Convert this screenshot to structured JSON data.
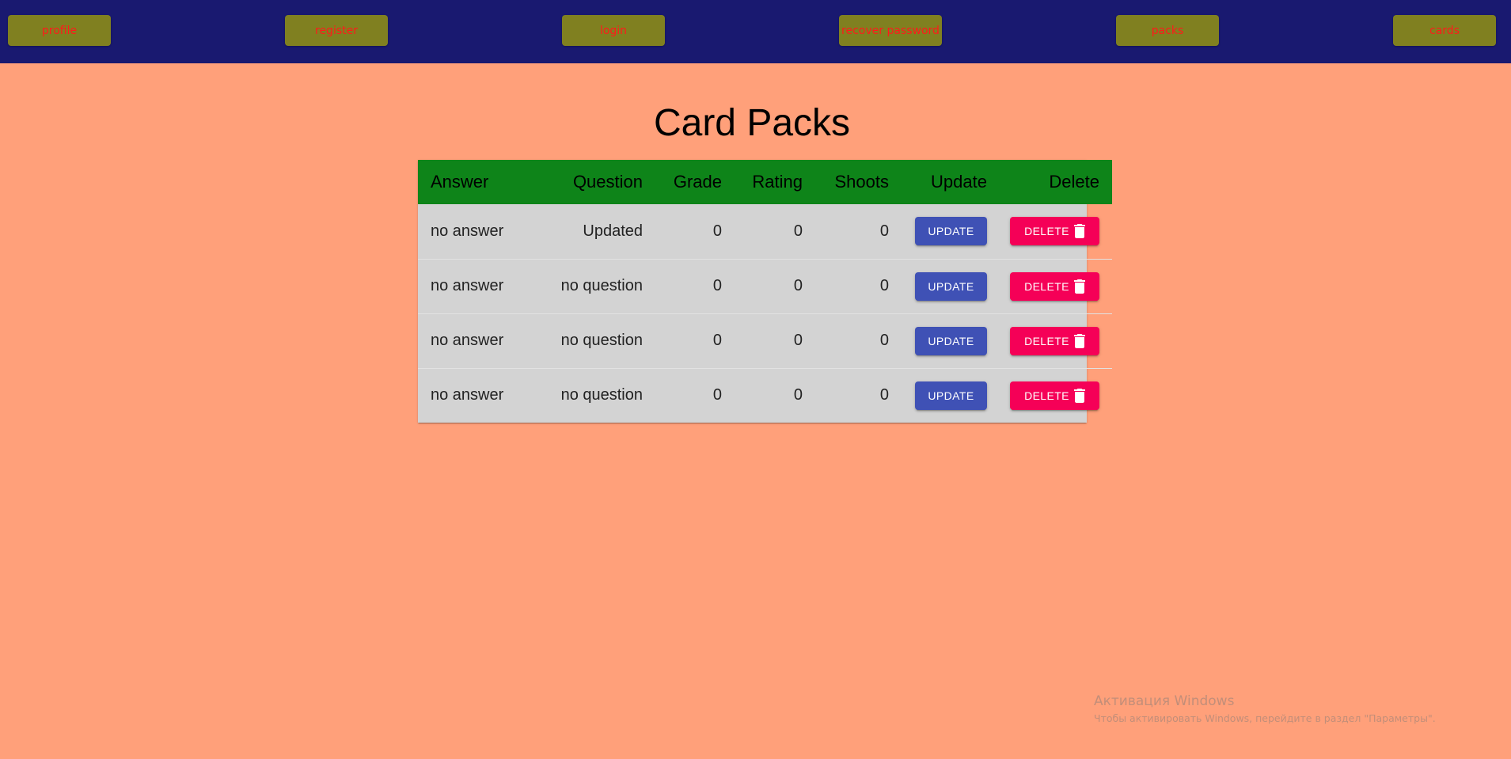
{
  "nav": {
    "items": [
      {
        "label": "profile"
      },
      {
        "label": "register"
      },
      {
        "label": "login"
      },
      {
        "label": "recover password"
      },
      {
        "label": "packs"
      },
      {
        "label": "cards"
      }
    ]
  },
  "page": {
    "title": "Card Packs"
  },
  "table": {
    "headers": {
      "answer": "Answer",
      "question": "Question",
      "grade": "Grade",
      "rating": "Rating",
      "shoots": "Shoots",
      "update": "Update",
      "delete": "Delete"
    },
    "rows": [
      {
        "answer": "no answer",
        "question": "Updated",
        "grade": "0",
        "rating": "0",
        "shoots": "0",
        "update_label": "UPDATE",
        "delete_label": "DELETE"
      },
      {
        "answer": "no answer",
        "question": "no question",
        "grade": "0",
        "rating": "0",
        "shoots": "0",
        "update_label": "UPDATE",
        "delete_label": "DELETE"
      },
      {
        "answer": "no answer",
        "question": "no question",
        "grade": "0",
        "rating": "0",
        "shoots": "0",
        "update_label": "UPDATE",
        "delete_label": "DELETE"
      },
      {
        "answer": "no answer",
        "question": "no question",
        "grade": "0",
        "rating": "0",
        "shoots": "0",
        "update_label": "UPDATE",
        "delete_label": "DELETE"
      }
    ]
  },
  "watermark": {
    "title": "Активация Windows",
    "subtitle": "Чтобы активировать Windows, перейдите в раздел \"Параметры\"."
  },
  "colors": {
    "background": "#FFA07A",
    "navbar": "#191970",
    "nav_button": "#808020",
    "nav_text": "#FF1A1A",
    "table_header": "#0E8419",
    "table_body": "#D3D3D3",
    "update_button": "#3F51B5",
    "delete_button": "#F50057"
  },
  "icons": {
    "delete": "trash-icon"
  }
}
